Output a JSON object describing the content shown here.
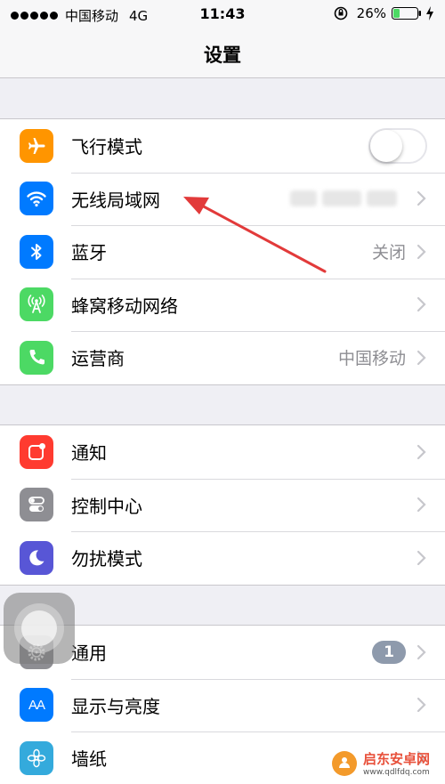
{
  "status_bar": {
    "carrier": "中国移动",
    "network": "4G",
    "time": "11:43",
    "battery": "26%"
  },
  "nav": {
    "title": "设置"
  },
  "groups": [
    {
      "rows": [
        {
          "label": "飞行模式",
          "icon": "airplane-icon",
          "color": "#ff9500",
          "control": "toggle",
          "toggle_on": false
        },
        {
          "label": "无线局域网",
          "icon": "wifi-icon",
          "color": "#007aff",
          "value_redacted": true
        },
        {
          "label": "蓝牙",
          "icon": "bluetooth-icon",
          "color": "#007aff",
          "value": "关闭"
        },
        {
          "label": "蜂窝移动网络",
          "icon": "cellular-icon",
          "color": "#4cd964"
        },
        {
          "label": "运营商",
          "icon": "phone-icon",
          "color": "#4cd964",
          "value": "中国移动"
        }
      ]
    },
    {
      "rows": [
        {
          "label": "通知",
          "icon": "notification-icon",
          "color": "#ff3b30"
        },
        {
          "label": "控制中心",
          "icon": "control-center-icon",
          "color": "#8e8e93"
        },
        {
          "label": "勿扰模式",
          "icon": "moon-icon",
          "color": "#5856d6"
        }
      ]
    },
    {
      "rows": [
        {
          "label": "通用",
          "icon": "gear-icon",
          "color": "#8e8e93",
          "badge": "1"
        },
        {
          "label": "显示与亮度",
          "icon": "display-icon",
          "color": "#007aff",
          "icon_text": "AA"
        },
        {
          "label": "墙纸",
          "icon": "wallpaper-icon",
          "color": "#34aadc"
        }
      ]
    }
  ],
  "watermark": {
    "name": "启东安卓网",
    "url": "www.qdlfdq.com"
  },
  "colors": {
    "background": "#efeff4",
    "separator": "#c8c7cc",
    "chevron": "#c7c7cc",
    "arrow": "#e23a3a"
  }
}
